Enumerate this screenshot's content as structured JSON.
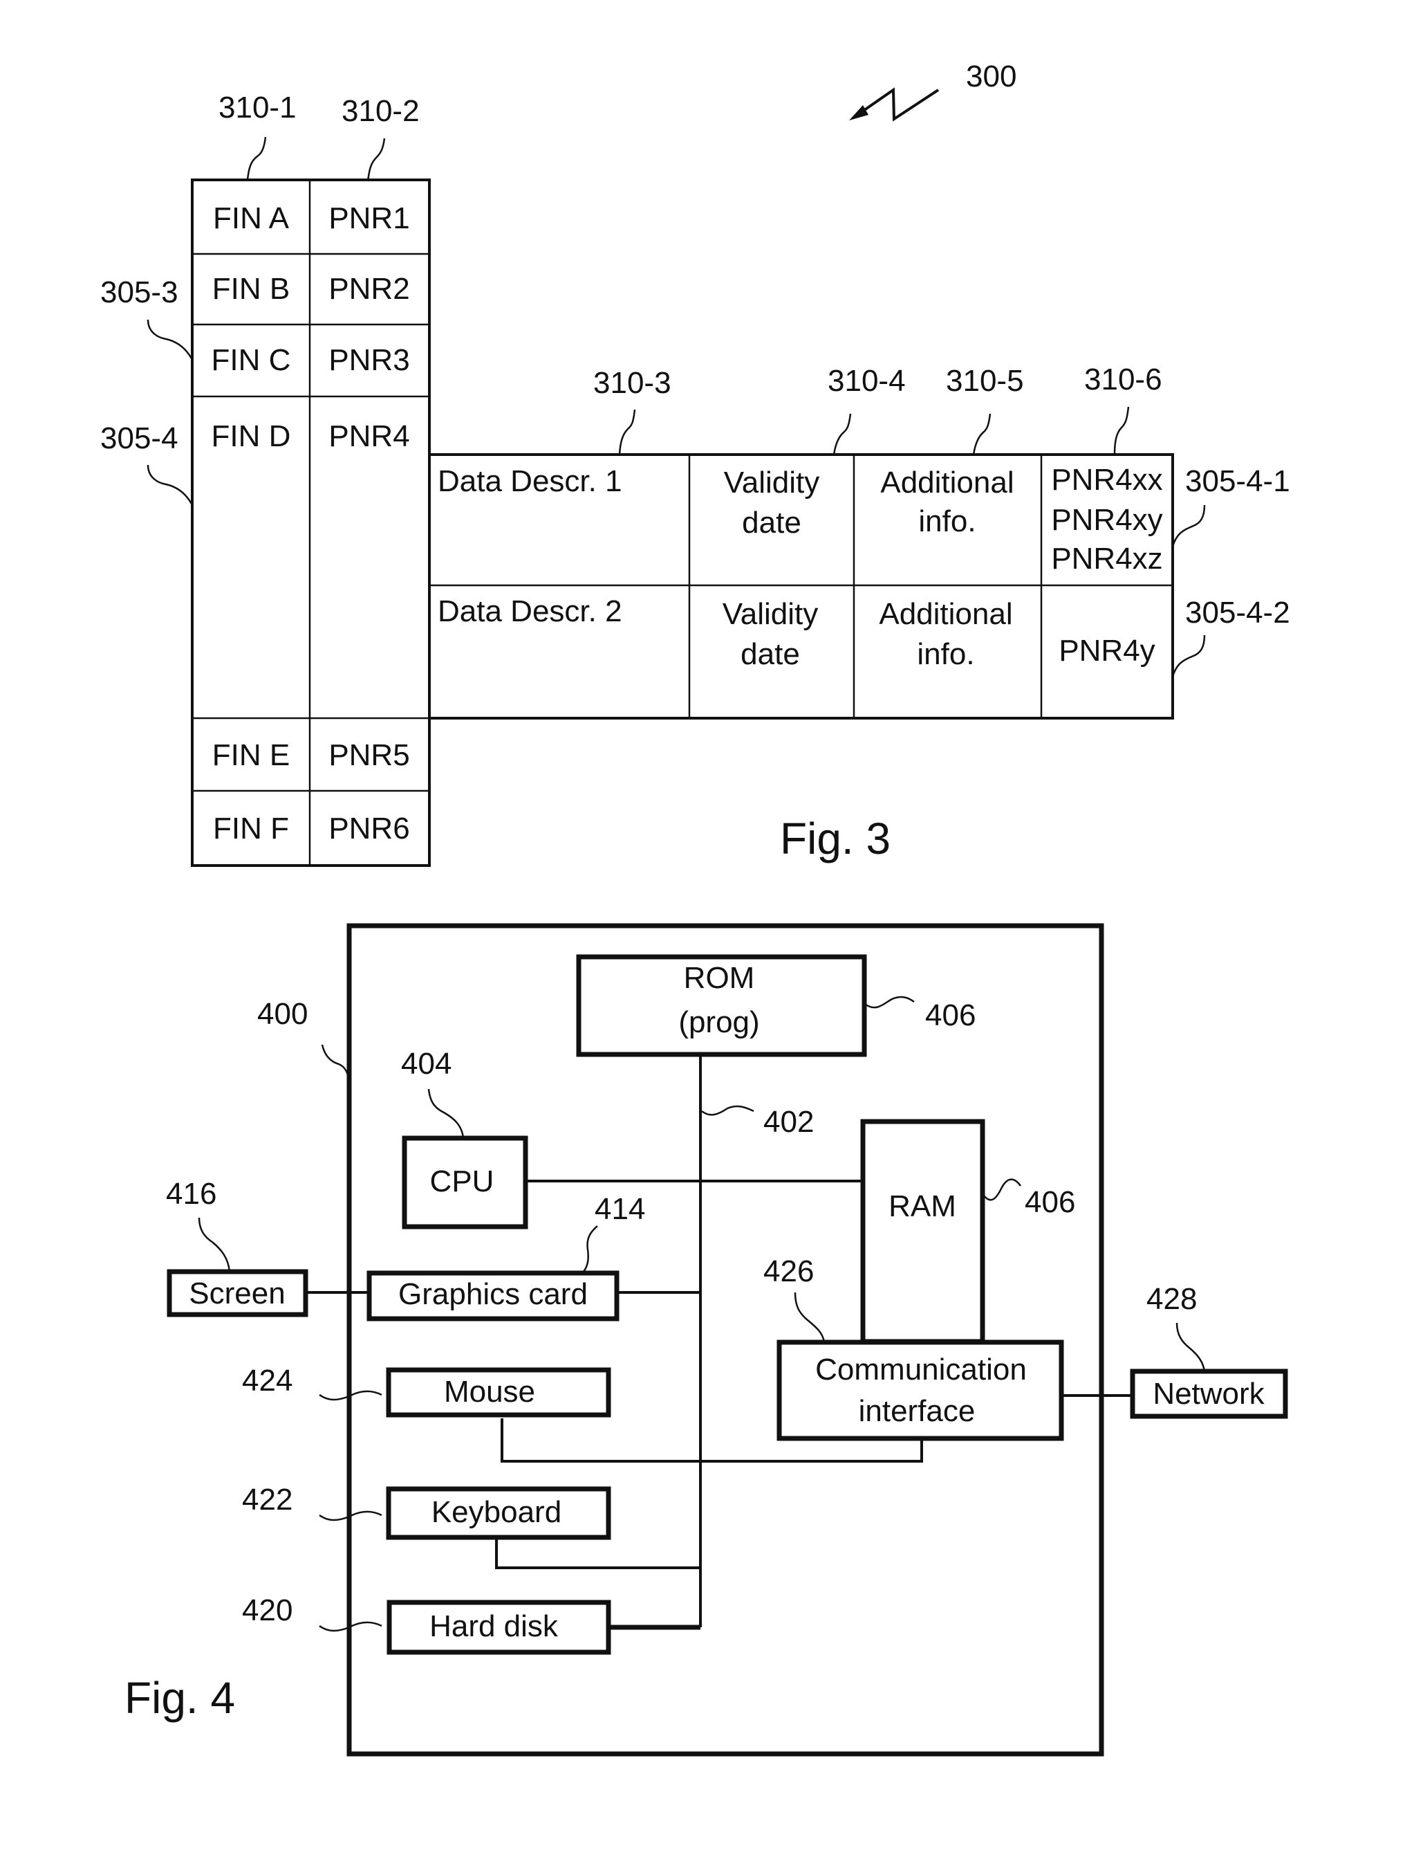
{
  "fig3": {
    "caption": "Fig. 3",
    "ref_main": "300",
    "column_refs": [
      "310-1",
      "310-2",
      "310-3",
      "310-4",
      "310-5",
      "310-6"
    ],
    "row_refs": [
      "305-3",
      "305-4",
      "305-4-1",
      "305-4-2"
    ],
    "main_table": {
      "rows": [
        {
          "fin": "FIN A",
          "pnr": "PNR1"
        },
        {
          "fin": "FIN B",
          "pnr": "PNR2"
        },
        {
          "fin": "FIN C",
          "pnr": "PNR3"
        },
        {
          "fin": "FIN D",
          "pnr": "PNR4"
        },
        {
          "fin": "FIN E",
          "pnr": "PNR5"
        },
        {
          "fin": "FIN F",
          "pnr": "PNR6"
        }
      ]
    },
    "sub_table": {
      "rows": [
        {
          "descr": "Data Descr. 1",
          "validity": [
            "Validity",
            "date"
          ],
          "info": [
            "Additional",
            "info."
          ],
          "pnrs": [
            "PNR4xx",
            "PNR4xy",
            "PNR4xz"
          ]
        },
        {
          "descr": "Data Descr. 2",
          "validity": [
            "Validity",
            "date"
          ],
          "info": [
            "Additional",
            "info."
          ],
          "pnrs": [
            "PNR4y"
          ]
        }
      ]
    }
  },
  "fig4": {
    "caption": "Fig. 4",
    "refs": {
      "device": "400",
      "bus": "402",
      "cpu": "404",
      "rom": "406",
      "ram": "406",
      "graphics": "414",
      "screen": "416",
      "harddisk": "420",
      "keyboard": "422",
      "mouse": "424",
      "comm": "426",
      "network": "428"
    },
    "blocks": {
      "rom": [
        "ROM",
        "(prog)"
      ],
      "cpu": "CPU",
      "ram": "RAM",
      "graphics": "Graphics card",
      "screen": "Screen",
      "mouse": "Mouse",
      "keyboard": "Keyboard",
      "harddisk": "Hard disk",
      "comm": [
        "Communication",
        "interface"
      ],
      "network": "Network"
    }
  }
}
